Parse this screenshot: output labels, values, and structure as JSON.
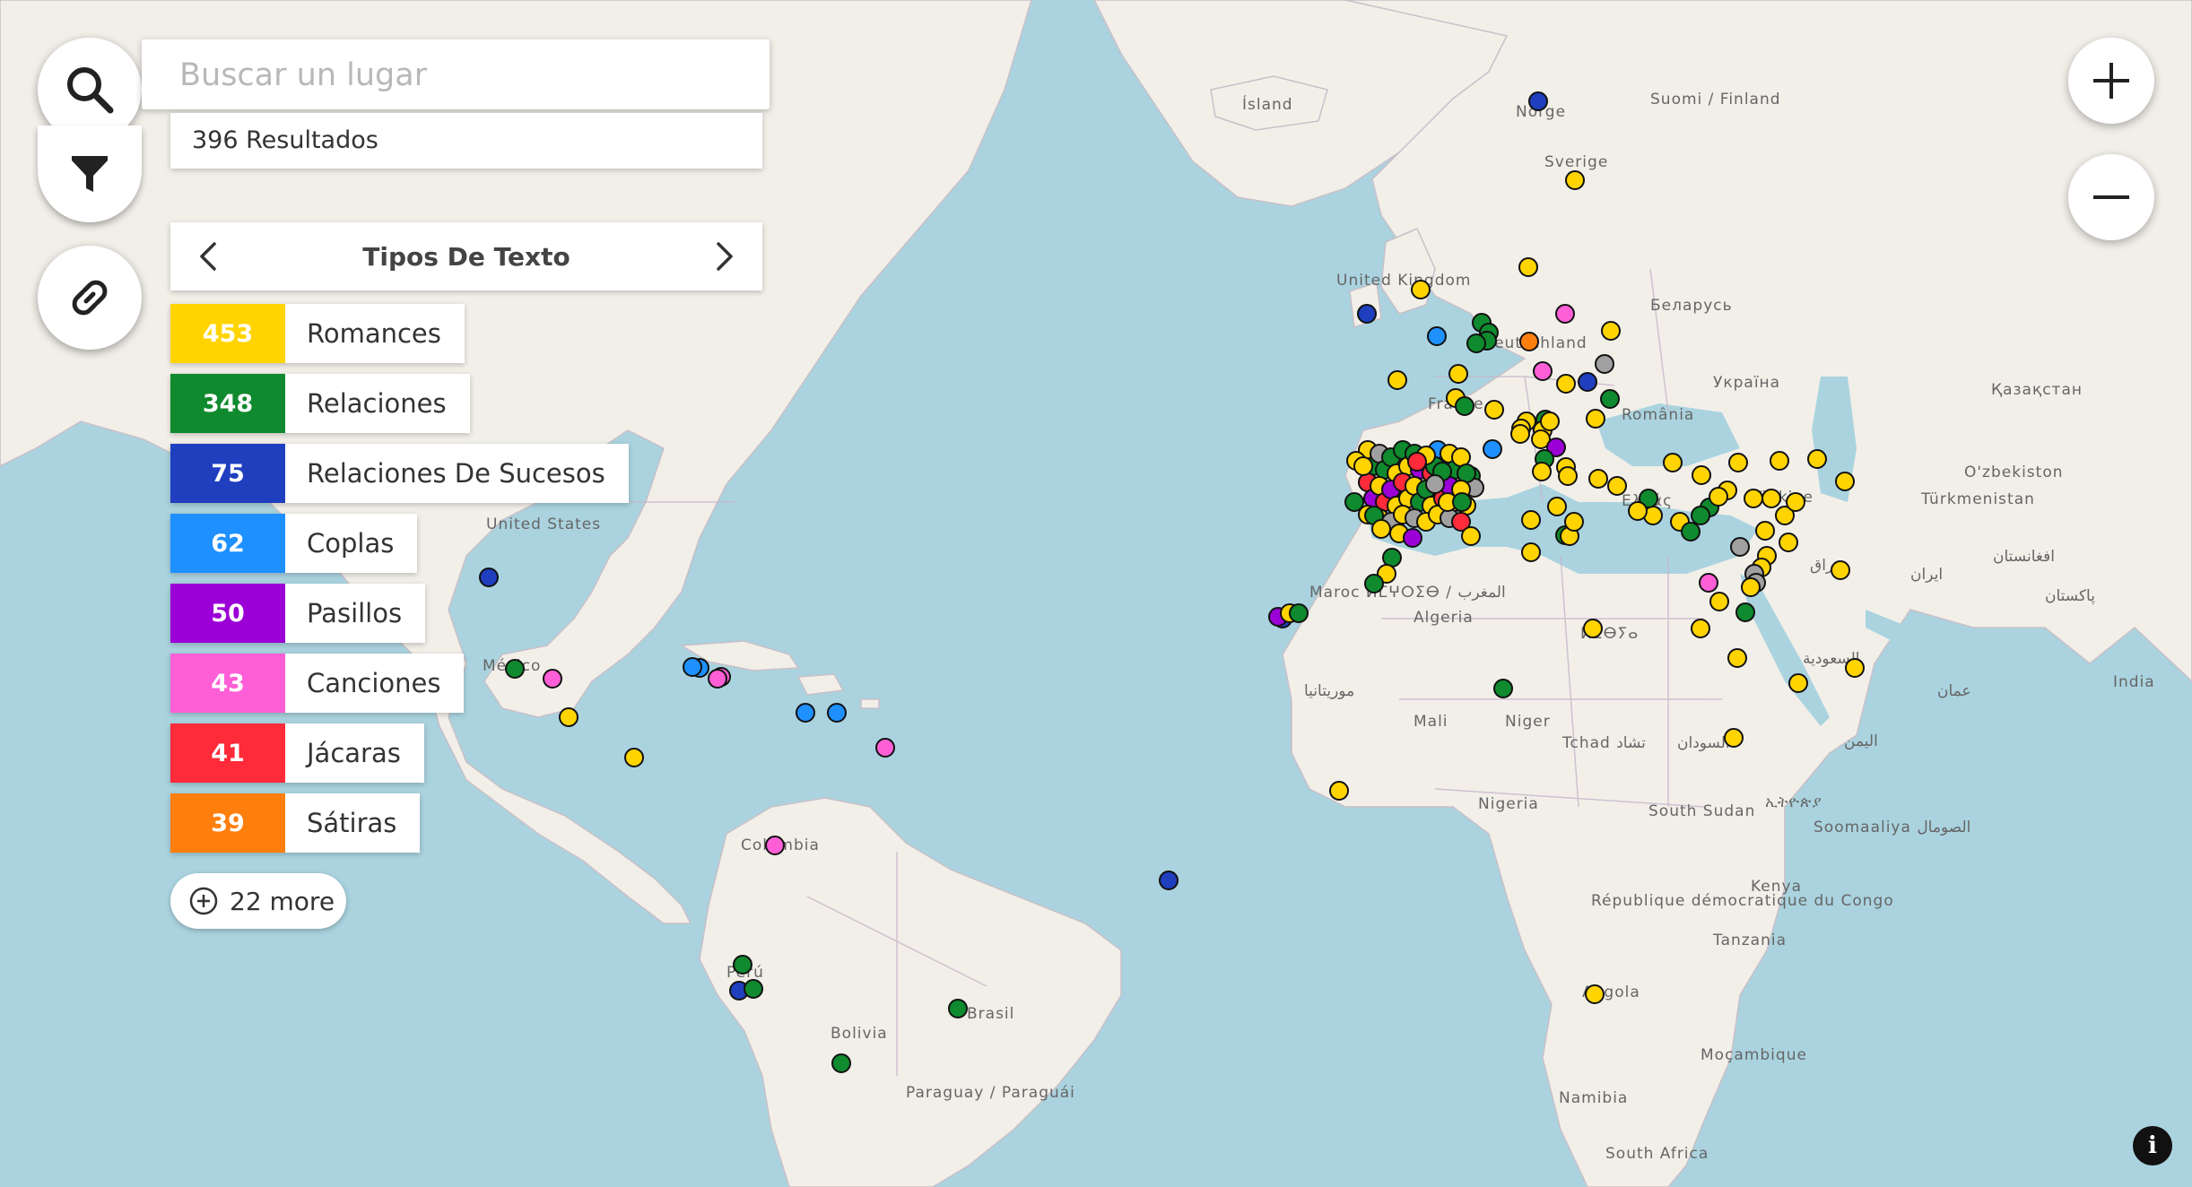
{
  "search": {
    "placeholder": "Buscar un lugar"
  },
  "results_label": "396 Resultados",
  "legend": {
    "title": "Tipos De Texto",
    "items": [
      {
        "count": "453",
        "label": "Romances",
        "color": "#ffd400"
      },
      {
        "count": "348",
        "label": "Relaciones",
        "color": "#0f8a2e"
      },
      {
        "count": "75",
        "label": "Relaciones De Sucesos",
        "color": "#1f3fbf"
      },
      {
        "count": "62",
        "label": "Coplas",
        "color": "#1e90ff"
      },
      {
        "count": "50",
        "label": "Pasillos",
        "color": "#9b00d6"
      },
      {
        "count": "43",
        "label": "Canciones",
        "color": "#ff5fd6"
      },
      {
        "count": "41",
        "label": "Jácaras",
        "color": "#ff2b3a"
      },
      {
        "count": "39",
        "label": "Sátiras",
        "color": "#ff7f0e"
      }
    ],
    "more_label": "22 more"
  },
  "other_color": "#a0a0a0",
  "icons": [
    "search-icon",
    "filter-icon",
    "link-icon",
    "chevron-left-icon",
    "chevron-right-icon",
    "plus-circle-icon",
    "zoom-in-icon",
    "zoom-out-icon",
    "info-icon"
  ],
  "map_labels": [
    "Ísland",
    "Norge",
    "Suomi / Finland",
    "Sverige",
    "United Kingdom",
    "Беларусь",
    "Deutschland",
    "Україна",
    "Қазақстан",
    "France",
    "România",
    "O'zbekiston",
    "Türkmenistan",
    "افغانستان",
    "ایران",
    "پاکستان",
    "India",
    "United States",
    "México",
    "Maroc ⵍⵎⵖⵔⵉⴱ / المغرب",
    "Algeria",
    "Ελλάς",
    "Türkiye",
    "عراق",
    "موريتانيا",
    "Mali",
    "Niger",
    "Tchad تشاد",
    "السودان",
    "ⵍⵉⴱⵢⴰ",
    "السعودية",
    "عمان",
    "اليمن",
    "Nigeria",
    "South Sudan",
    "ኢትዮጵያ",
    "Soomaaliya الصومال",
    "Colombia",
    "Kenya",
    "République démocratique du Congo",
    "Tanzania",
    "Perú",
    "Brasil",
    "Bolivia",
    "Angola",
    "Paraguay / Paraguái",
    "Moçambique",
    "Namibia",
    "South Africa"
  ]
}
